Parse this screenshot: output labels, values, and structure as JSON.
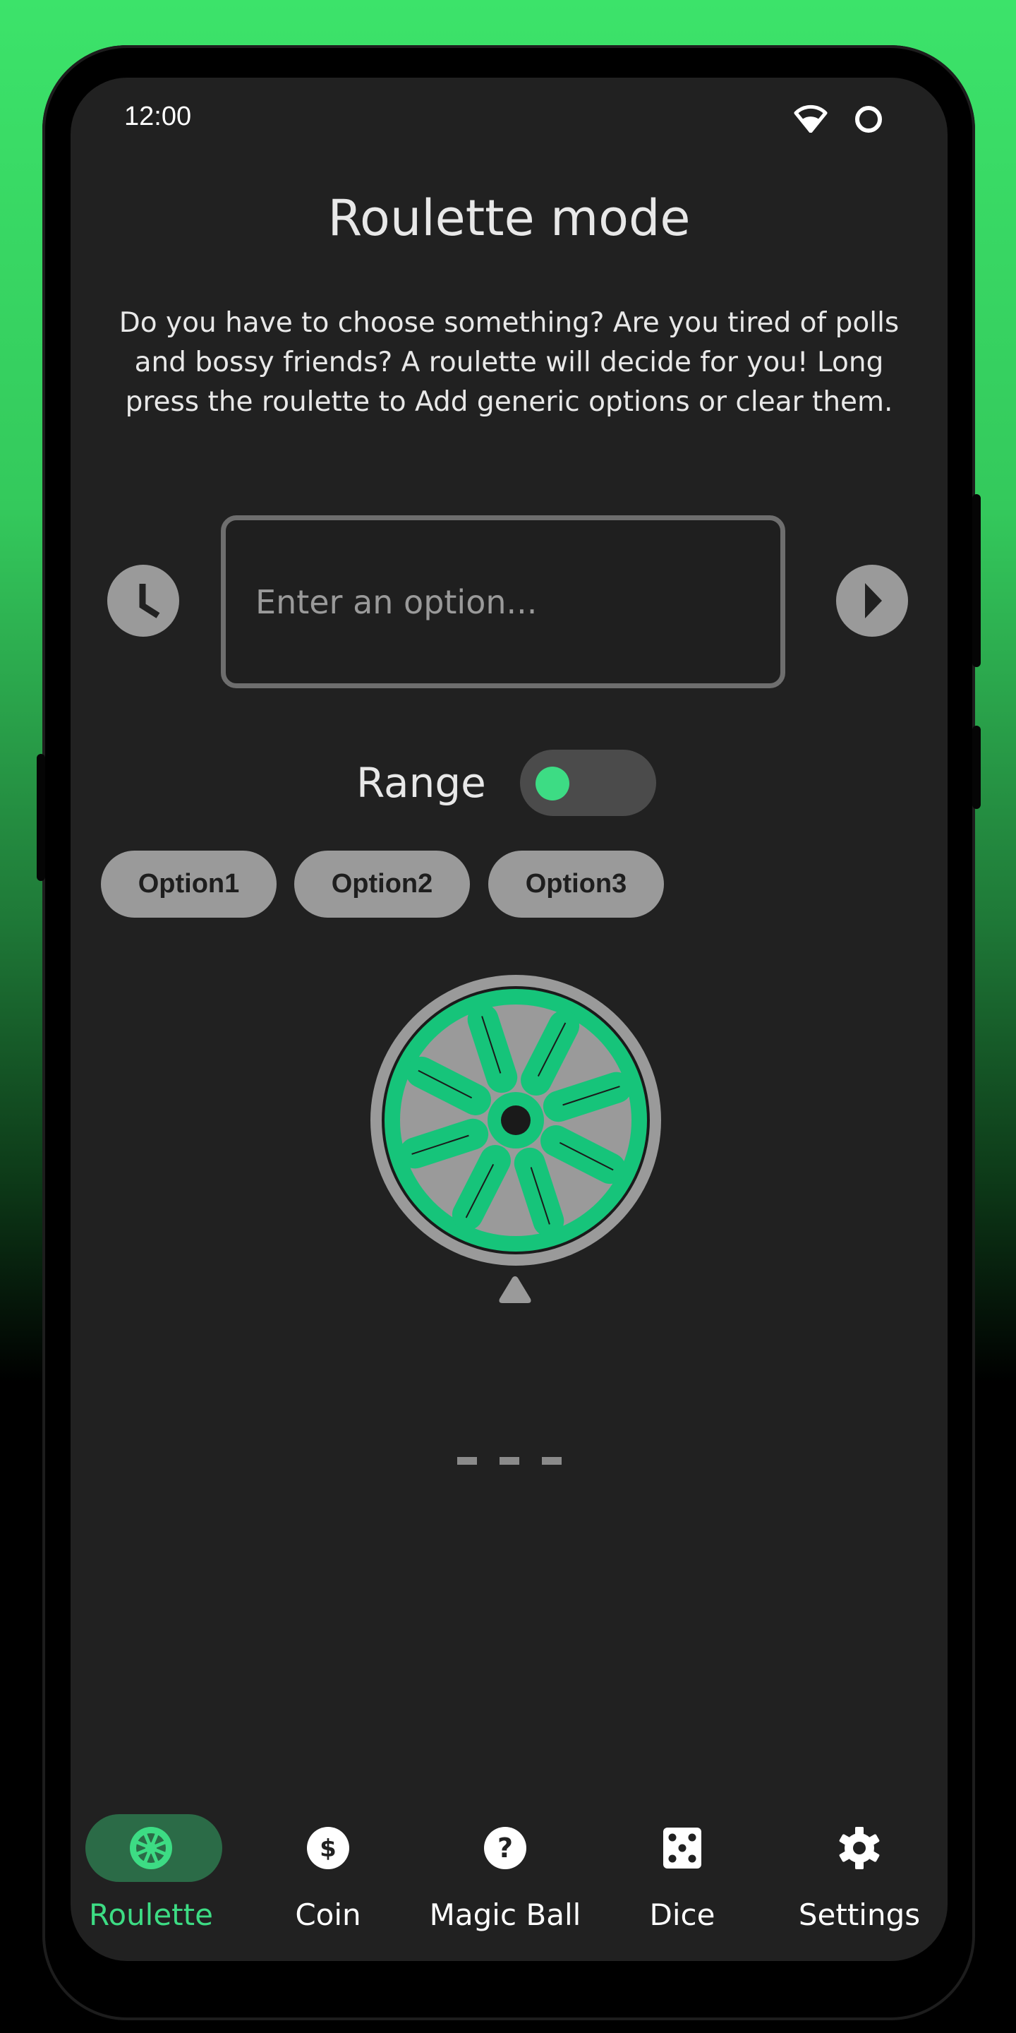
{
  "status_bar": {
    "time": "12:00",
    "icons": [
      "wifi-icon",
      "battery-circle-icon"
    ]
  },
  "page": {
    "title": "Roulette mode",
    "description": "Do you have to choose something? Are you tired of polls and bossy friends? A roulette will decide for you! Long press the roulette to Add generic options or clear them."
  },
  "input_row": {
    "history_icon": "clock-icon",
    "option_input": {
      "placeholder": "Enter an option...",
      "value": ""
    },
    "submit_icon": "play-arrow-icon"
  },
  "range": {
    "label": "Range",
    "enabled": false
  },
  "options": [
    "Option1",
    "Option2",
    "Option3"
  ],
  "roulette": {
    "icon": "roulette-wheel",
    "spokes": 8,
    "pointer_icon": "triangle-pointer-icon"
  },
  "result": {
    "text": "- - -"
  },
  "bottom_nav": {
    "active": "Roulette",
    "items": [
      {
        "label": "Roulette",
        "icon": "roulette-icon"
      },
      {
        "label": "Coin",
        "icon": "dollar-coin-icon"
      },
      {
        "label": "Magic Ball",
        "icon": "question-circle-icon"
      },
      {
        "label": "Dice",
        "icon": "dice-five-icon"
      },
      {
        "label": "Settings",
        "icon": "gear-icon"
      }
    ]
  },
  "colors": {
    "accent": "#3ddc84",
    "wheel_green": "#16c47a",
    "screen_bg": "#212121",
    "muted_gray": "#9a9a9a",
    "active_pill": "#2b6b47"
  }
}
